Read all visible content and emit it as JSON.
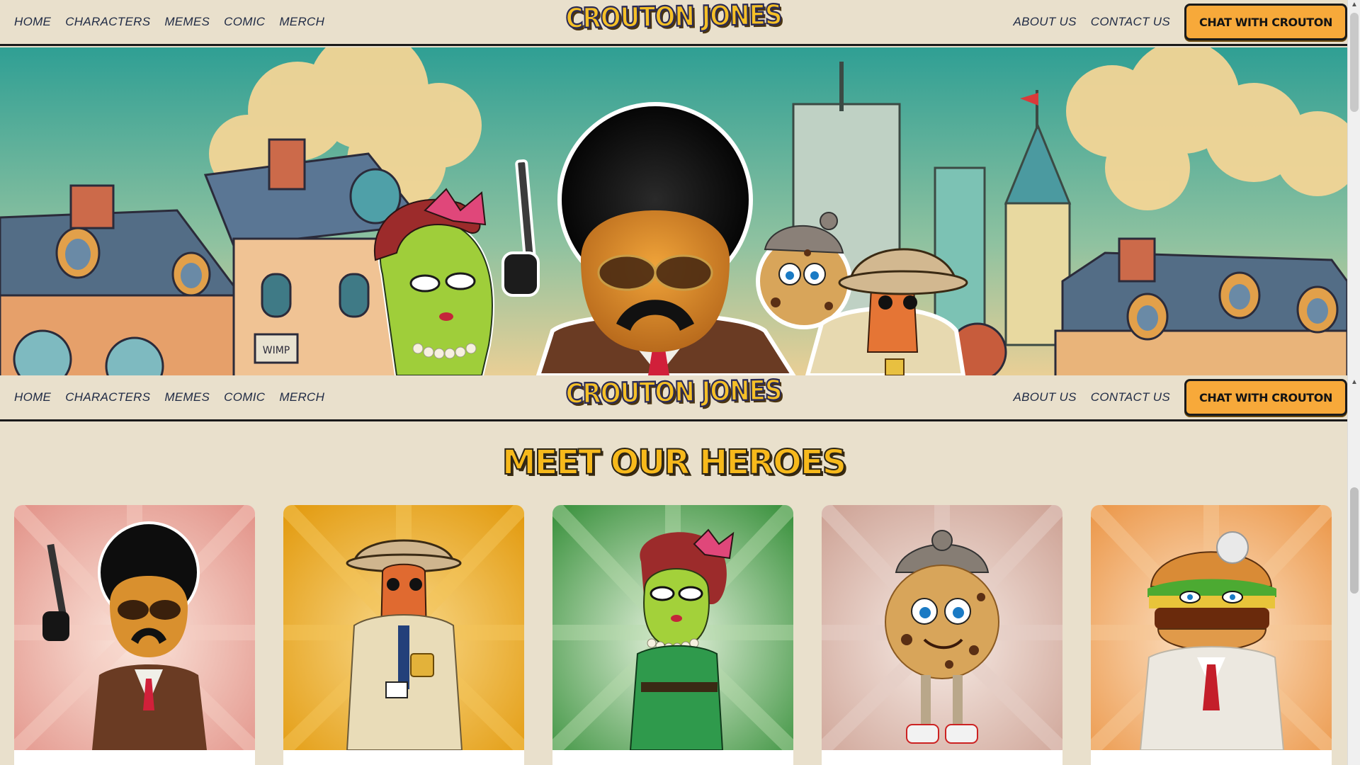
{
  "nav": {
    "left_links": [
      "HOME",
      "CHARACTERS",
      "MEMES",
      "COMIC",
      "MERCH"
    ],
    "right_links": [
      "ABOUT US",
      "CONTACT US"
    ],
    "logo_text": "CROUTON JONES",
    "cta_label": "CHAT WITH CROUTON"
  },
  "sticky_nav": {
    "left_links": [
      "HOME",
      "CHARACTERS",
      "MEMES",
      "COMIC",
      "MERCH"
    ],
    "right_links": [
      "ABOUT US",
      "CONTACT US"
    ],
    "logo_text": "CROUTON JONES",
    "cta_label": "CHAT WITH CROUTON"
  },
  "hero": {
    "sign_text": "WIMP"
  },
  "section": {
    "title": "MEET OUR HEROES"
  },
  "characters": [
    {
      "icon": "crouton-detective-icon",
      "bg": "#e8a9a0"
    },
    {
      "icon": "hotdog-detective-icon",
      "bg": "#eaa826"
    },
    {
      "icon": "pickle-lady-icon",
      "bg": "#4c9e4d"
    },
    {
      "icon": "cookie-character-icon",
      "bg": "#dcbcb0"
    },
    {
      "icon": "burger-boss-icon",
      "bg": "#f0a560"
    }
  ],
  "colors": {
    "background": "#e9e0cc",
    "cta": "#f7a93a",
    "title_yellow": "#f7b91b",
    "nav_text": "#1f2a44"
  }
}
